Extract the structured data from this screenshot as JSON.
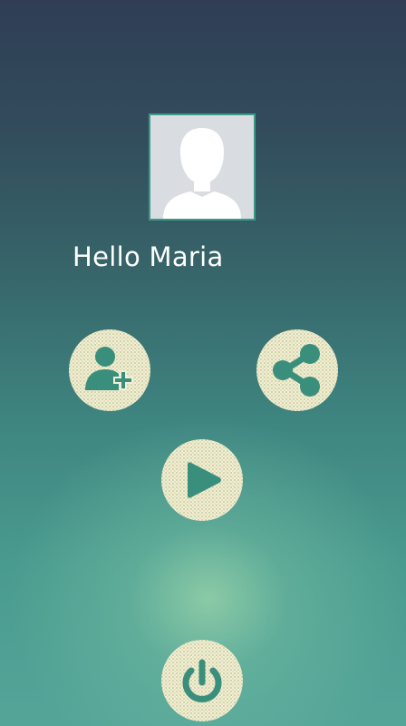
{
  "profile": {
    "greeting": "Hello Maria",
    "avatar_icon": "person-silhouette-icon"
  },
  "actions": [
    {
      "id": "add-user",
      "icon": "add-user-icon"
    },
    {
      "id": "share",
      "icon": "share-icon"
    },
    {
      "id": "play",
      "icon": "play-icon"
    },
    {
      "id": "power",
      "icon": "power-icon"
    }
  ],
  "colors": {
    "accent": "#3a8f7c",
    "button_face": "#f1eed7",
    "avatar_border": "#3a9a86",
    "background_top": "#2f3e55",
    "background_bottom": "#55a599",
    "text": "#ffffff"
  }
}
